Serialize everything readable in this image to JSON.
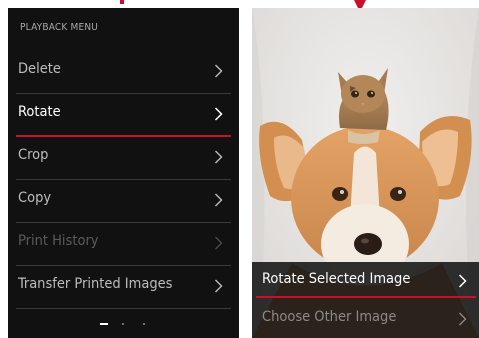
{
  "colors": {
    "accent": "#c8102e",
    "menu_bg": "#111111",
    "text": "#bdbdbd",
    "text_selected": "#ffffff",
    "text_disabled": "#5a5a5a"
  },
  "menu": {
    "title": "PLAYBACK MENU",
    "items": [
      {
        "label": "Delete",
        "state": "normal",
        "icon": "chevron-right-icon"
      },
      {
        "label": "Rotate",
        "state": "selected",
        "icon": "chevron-right-icon"
      },
      {
        "label": "Crop",
        "state": "normal",
        "icon": "chevron-right-icon"
      },
      {
        "label": "Copy",
        "state": "normal",
        "icon": "chevron-right-icon"
      },
      {
        "label": "Print History",
        "state": "disabled",
        "icon": "chevron-right-icon"
      },
      {
        "label": "Transfer Printed Images",
        "state": "normal",
        "icon": "chevron-right-icon"
      }
    ],
    "pagination": {
      "pages": 3,
      "current": 1
    }
  },
  "photo": {
    "subject": "kitten sitting on dog's head"
  },
  "submenu": {
    "items": [
      {
        "label": "Rotate Selected Image",
        "state": "selected",
        "icon": "chevron-right-icon"
      },
      {
        "label": "Choose Other Image",
        "state": "dim",
        "icon": "chevron-right-icon"
      }
    ]
  }
}
